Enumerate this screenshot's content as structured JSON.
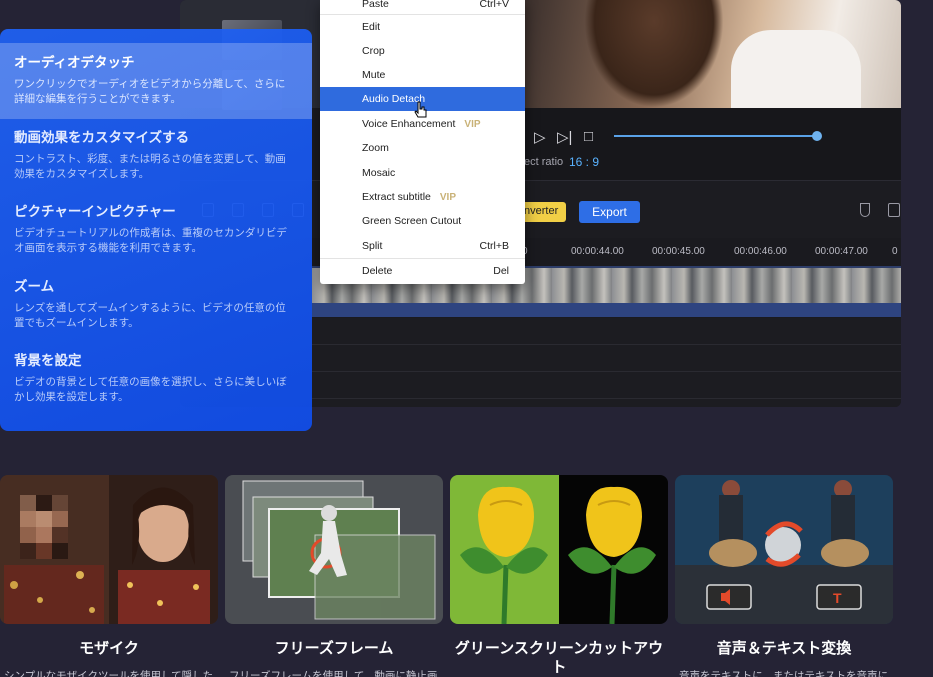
{
  "editor": {
    "aspect_label": "ect ratio",
    "aspect_value": "16 : 9",
    "converter_label": "nverter",
    "export_label": "Export",
    "ruler_ticks": [
      "00:00:44.00",
      "00:00:45.00",
      "00:00:46.00",
      "00:00:47.00"
    ],
    "ruler_left_partial": "0"
  },
  "context_menu": {
    "items": [
      {
        "label": "Paste",
        "shortcut": "Ctrl+V"
      },
      {
        "label": "Edit"
      },
      {
        "label": "Crop"
      },
      {
        "label": "Mute"
      },
      {
        "label": "Audio Detach",
        "active": true
      },
      {
        "label": "Voice Enhancement",
        "vip": "VIP"
      },
      {
        "label": "Zoom"
      },
      {
        "label": "Mosaic"
      },
      {
        "label": "Extract subtitle",
        "vip": "VIP"
      },
      {
        "label": "Green Screen Cutout"
      },
      {
        "label": "Split",
        "shortcut": "Ctrl+B"
      },
      {
        "label": "Delete",
        "shortcut": "Del"
      }
    ]
  },
  "features": [
    {
      "title": "オーディオデタッチ",
      "desc_line1": "ワンクリックでオーディオをビデオから分離して、さらに",
      "desc_line2": "詳細な編集を行うことができます。"
    },
    {
      "title": "動画効果をカスタマイズする",
      "desc_line1": "コントラスト、彩度、または明るさの値を変更して、動画",
      "desc_line2": "効果をカスタマイズします。"
    },
    {
      "title": "ピクチャーインピクチャー",
      "desc_line1": "ビデオチュートリアルの作成者は、重複のセカンダリビデ",
      "desc_line2": "オ画面を表示する機能を利用できます。"
    },
    {
      "title": "ズーム",
      "desc_line1": "レンズを通してズームインするように、ビデオの任意の位",
      "desc_line2": "置でもズームインします。"
    },
    {
      "title": "背景を設定",
      "desc_line1": "ビデオの背景として任意の画像を選択し、さらに美しいぼ",
      "desc_line2": "かし効果を設定します。"
    }
  ],
  "cards": [
    {
      "title": "モザイク",
      "desc": "シンプルなモザイクツールを使用して隠した"
    },
    {
      "title": "フリーズフレーム",
      "desc": "フリーズフレームを使用して、動画に静止画"
    },
    {
      "title_line1": "グリーンスクリーンカットアウ",
      "title_line2": "ト"
    },
    {
      "title": "音声＆テキスト変換",
      "desc": "音声をテキストに、またはテキストを音声に"
    }
  ]
}
